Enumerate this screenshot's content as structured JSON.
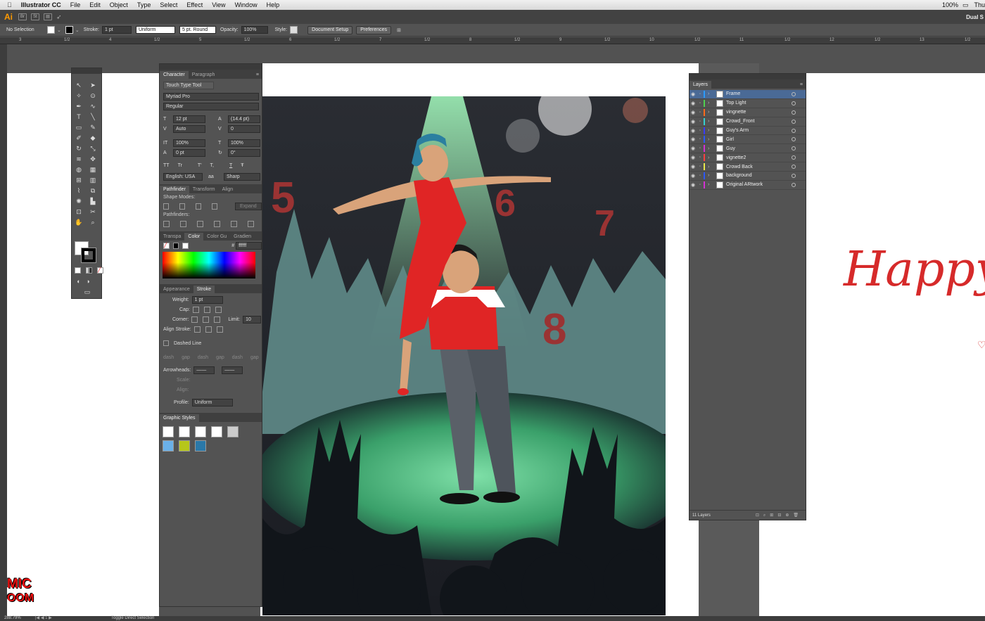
{
  "menubar": {
    "app": "Illustrator CC",
    "items": [
      "File",
      "Edit",
      "Object",
      "Type",
      "Select",
      "Effect",
      "View",
      "Window",
      "Help"
    ],
    "right_status": "100%",
    "right_truncated": "Thu"
  },
  "approw": {
    "logo": "Ai",
    "br": "Br",
    "st": "St",
    "workspace": "Dual S"
  },
  "controlbar": {
    "selection": "No Selection",
    "stroke_label": "Stroke:",
    "stroke_value": "1 pt",
    "profile": "Uniform",
    "brush": "5 pt. Round",
    "opacity_label": "Opacity:",
    "opacity_value": "100%",
    "style_label": "Style:",
    "document_setup": "Document Setup",
    "preferences": "Preferences"
  },
  "ruler_labels": [
    "3",
    "1/2",
    "4",
    "1/2",
    "5",
    "1/2",
    "6",
    "1/2",
    "7",
    "1/2",
    "8",
    "1/2",
    "9",
    "1/2",
    "10",
    "1/2",
    "11",
    "1/2",
    "12",
    "1/2",
    "13",
    "1/2",
    "14"
  ],
  "character": {
    "tabs": [
      "Character",
      "Paragraph"
    ],
    "touch_type": "Touch Type Tool",
    "font": "Myriad Pro",
    "style": "Regular",
    "size": "12 pt",
    "leading": "(14.4 pt)",
    "kerning": "Auto",
    "tracking": "0",
    "vscale": "100%",
    "hscale": "100%",
    "baseline": "0 pt",
    "rotation": "0°",
    "glyphs": [
      "TT",
      "Tr",
      "T'",
      "T,",
      "T",
      "Ŧ"
    ],
    "language": "English: USA",
    "aa": "Sharp"
  },
  "pathfinder": {
    "tabs": [
      "Pathfinder",
      "Transform",
      "Align"
    ],
    "shape_modes": "Shape Modes:",
    "expand": "Expand",
    "pathfinders": "Pathfinders:"
  },
  "color": {
    "tabs": [
      "Transpa",
      "Color",
      "Color Gu",
      "Gradien"
    ],
    "hex_label": "#",
    "hex": "ffffff"
  },
  "stroke": {
    "tabs": [
      "Appearance",
      "Stroke"
    ],
    "weight_label": "Weight:",
    "weight": "1 pt",
    "cap_label": "Cap:",
    "corner_label": "Corner:",
    "limit_label": "Limit:",
    "limit": "10",
    "align_label": "Align Stroke:",
    "dashed": "Dashed Line",
    "dash_labels": [
      "dash",
      "gap",
      "dash",
      "gap",
      "dash",
      "gap"
    ],
    "arrowheads": "Arrowheads:",
    "scale": "Scale:",
    "align2": "Align:",
    "profile_label": "Profile:",
    "profile": "Uniform"
  },
  "graphic_styles": {
    "title": "Graphic Styles"
  },
  "layers": {
    "title": "Layers",
    "items": [
      {
        "name": "Frame",
        "color": "#2b9bff",
        "selected": true
      },
      {
        "name": "Top Light",
        "color": "#4fd04f"
      },
      {
        "name": "vingnette",
        "color": "#ff6a1a"
      },
      {
        "name": "Crowd_Front",
        "color": "#35d0d0"
      },
      {
        "name": "Guy's Arm",
        "color": "#3a3aff"
      },
      {
        "name": "Girl",
        "color": "#2b58ff"
      },
      {
        "name": "Guy",
        "color": "#d430d4"
      },
      {
        "name": "vignette2",
        "color": "#ff4040"
      },
      {
        "name": "Crowd Back",
        "color": "#e8e84a"
      },
      {
        "name": "background",
        "color": "#2b58ff"
      },
      {
        "name": "Original ARtwork",
        "color": "#d430d4"
      }
    ],
    "count": "11 Layers"
  },
  "artwork": {
    "numbers": [
      "5",
      "6",
      "7",
      "8"
    ]
  },
  "side_text": "Happy",
  "logo_text": [
    "MIC",
    "OOM"
  ],
  "status": {
    "zoom": "288.79%",
    "hint": "Toggle Direct Selection"
  },
  "colors": {
    "panel_bg": "#535353",
    "selection": "#4a6a96",
    "menu_bg": "#e6e6e6",
    "accent_red": "#d62a2a"
  }
}
